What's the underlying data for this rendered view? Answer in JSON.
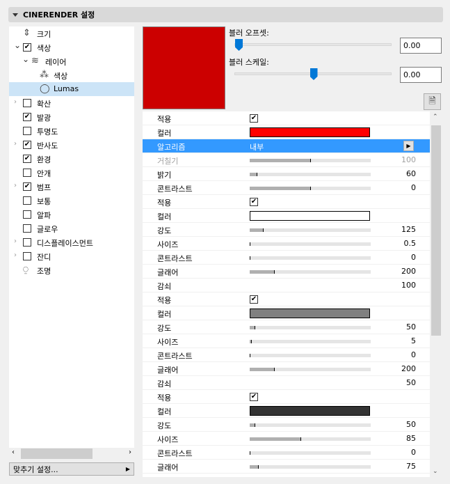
{
  "panel": {
    "title": "CINERENDER 설정"
  },
  "tree": [
    {
      "label": "크기",
      "icon": "size-icon",
      "arrow": "",
      "check": null,
      "indent": 0
    },
    {
      "label": "색상",
      "arrow": "down",
      "check": true,
      "indent": 0
    },
    {
      "label": "레이어",
      "icon": "layers-icon",
      "arrow": "down",
      "check": null,
      "indent": 1
    },
    {
      "label": "색상",
      "icon": "color-circles-icon",
      "arrow": "",
      "check": null,
      "indent": 2
    },
    {
      "label": "Lumas",
      "icon": "sphere-icon",
      "arrow": "",
      "check": null,
      "indent": 2,
      "selected": true
    },
    {
      "label": "확산",
      "arrow": "right",
      "check": false,
      "indent": 0
    },
    {
      "label": "발광",
      "arrow": "",
      "check": true,
      "indent": 0
    },
    {
      "label": "투명도",
      "arrow": "",
      "check": false,
      "indent": 0
    },
    {
      "label": "반사도",
      "arrow": "right",
      "check": true,
      "indent": 0
    },
    {
      "label": "환경",
      "arrow": "",
      "check": true,
      "indent": 0
    },
    {
      "label": "안개",
      "arrow": "",
      "check": false,
      "indent": 0
    },
    {
      "label": "범프",
      "arrow": "right",
      "check": true,
      "indent": 0
    },
    {
      "label": "보통",
      "arrow": "",
      "check": false,
      "indent": 0
    },
    {
      "label": "알파",
      "arrow": "",
      "check": false,
      "indent": 0
    },
    {
      "label": "글로우",
      "arrow": "",
      "check": false,
      "indent": 0
    },
    {
      "label": "디스플레이스먼트",
      "arrow": "right",
      "check": false,
      "indent": 0
    },
    {
      "label": "잔디",
      "arrow": "right",
      "check": false,
      "indent": 0
    },
    {
      "label": "조명",
      "icon": "light-icon",
      "arrow": "",
      "check": null,
      "indent": 0
    }
  ],
  "fit_button": {
    "label": "맞추기 설정..."
  },
  "preview": {
    "color": "#cc0000"
  },
  "blur_offset": {
    "label": "블러 오프셋:",
    "value": "0.00",
    "fraction": 0.0
  },
  "blur_scale": {
    "label": "블러 스케일:",
    "value": "0.00",
    "fraction": 0.5
  },
  "rows": [
    {
      "label": "적용",
      "type": "check",
      "checked": true
    },
    {
      "label": "컬러",
      "type": "color",
      "color": "#ff0000"
    },
    {
      "label": "알고리즘",
      "type": "menu",
      "value": "내부",
      "highlight": true
    },
    {
      "label": "거칠기",
      "type": "slider",
      "value": "100",
      "fraction": 0.5,
      "disabled": true
    },
    {
      "label": "밝기",
      "type": "slider",
      "value": "60",
      "fraction": 0.06
    },
    {
      "label": "콘트라스트",
      "type": "slider",
      "value": "0",
      "fraction": 0.5
    },
    {
      "label": "적용",
      "type": "check",
      "checked": true
    },
    {
      "label": "컬러",
      "type": "color",
      "color": "#ffffff"
    },
    {
      "label": "강도",
      "type": "slider",
      "value": "125",
      "fraction": 0.11
    },
    {
      "label": "사이즈",
      "type": "slider",
      "value": "0.5",
      "fraction": 0.0
    },
    {
      "label": "콘트라스트",
      "type": "slider",
      "value": "0",
      "fraction": 0.0
    },
    {
      "label": "글래어",
      "type": "slider",
      "value": "200",
      "fraction": 0.2
    },
    {
      "label": "감쇠",
      "type": "text",
      "value": "100"
    },
    {
      "label": "적용",
      "type": "check",
      "checked": true
    },
    {
      "label": "컬러",
      "type": "color",
      "color": "#808080"
    },
    {
      "label": "강도",
      "type": "slider",
      "value": "50",
      "fraction": 0.04
    },
    {
      "label": "사이즈",
      "type": "slider",
      "value": "5",
      "fraction": 0.01
    },
    {
      "label": "콘트라스트",
      "type": "slider",
      "value": "0",
      "fraction": 0.0
    },
    {
      "label": "글래어",
      "type": "slider",
      "value": "200",
      "fraction": 0.2
    },
    {
      "label": "감쇠",
      "type": "text",
      "value": "50"
    },
    {
      "label": "적용",
      "type": "check",
      "checked": true
    },
    {
      "label": "컬러",
      "type": "color",
      "color": "#333333"
    },
    {
      "label": "강도",
      "type": "slider",
      "value": "50",
      "fraction": 0.04
    },
    {
      "label": "사이즈",
      "type": "slider",
      "value": "85",
      "fraction": 0.42
    },
    {
      "label": "콘트라스트",
      "type": "slider",
      "value": "0",
      "fraction": 0.0
    },
    {
      "label": "글래어",
      "type": "slider",
      "value": "75",
      "fraction": 0.07
    }
  ]
}
